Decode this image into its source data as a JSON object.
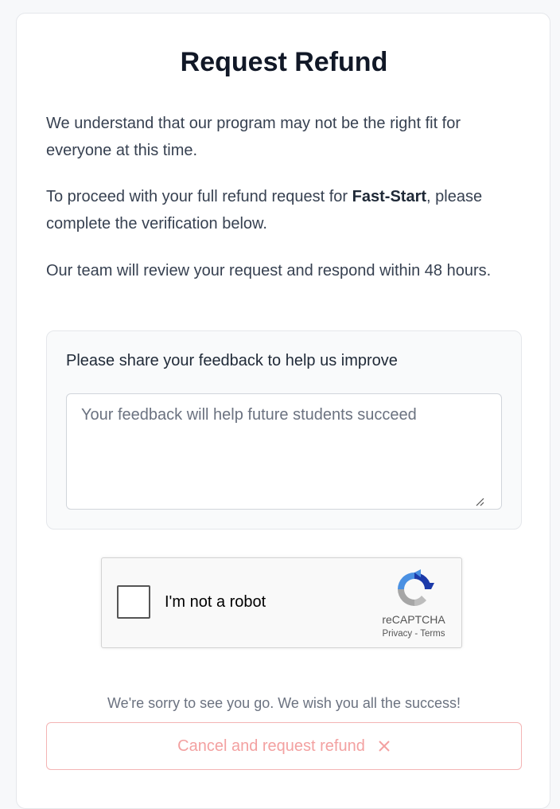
{
  "header": {
    "title": "Request Refund"
  },
  "intro": {
    "p1": "We understand that our program may not be the right fit for everyone at this time.",
    "p2_before": "To proceed with your full refund request for ",
    "p2_program": "Fast-Start",
    "p2_after": ", please complete the verification below.",
    "p3": "Our team will review your request and respond within 48 hours."
  },
  "feedback": {
    "label": "Please share your feedback to help us improve",
    "placeholder": "Your feedback will help future students succeed",
    "value": ""
  },
  "captcha": {
    "label": "I'm not a robot",
    "brand": "reCAPTCHA",
    "privacy": "Privacy",
    "separator": " - ",
    "terms": "Terms",
    "checked": false
  },
  "footer": {
    "farewell": "We're sorry to see you go. We wish you all the success!",
    "cancel_label": "Cancel and request refund",
    "cancel_icon": "close-icon"
  },
  "colors": {
    "accent_danger": "#f3a1a1",
    "border_danger": "#f4b4b4",
    "title": "#111827",
    "text": "#374151"
  }
}
